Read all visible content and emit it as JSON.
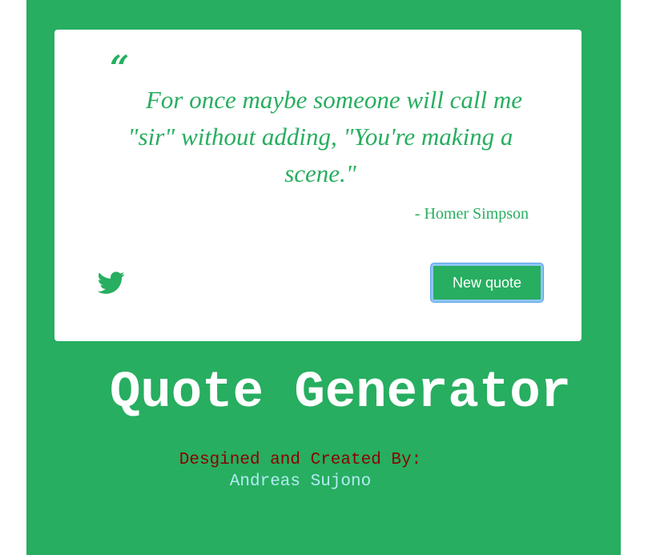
{
  "quote": {
    "open_mark": "“",
    "text": "For once maybe someone will call me \"sir\" without adding, \"You're making a scene.\"",
    "author": "- Homer Simpson"
  },
  "actions": {
    "tweet_icon": "twitter-icon",
    "new_quote_label": "New quote"
  },
  "title": "Quote Generator",
  "credits": {
    "label": "Desgined and Created By:",
    "author": "Andreas Sujono"
  },
  "colors": {
    "background": "#27ae60",
    "card": "#ffffff",
    "quote_text": "#27ae60",
    "credits_label": "#8b0000",
    "credits_author": "#b2ebf2",
    "button_focus_ring": "#8ec5f5"
  }
}
